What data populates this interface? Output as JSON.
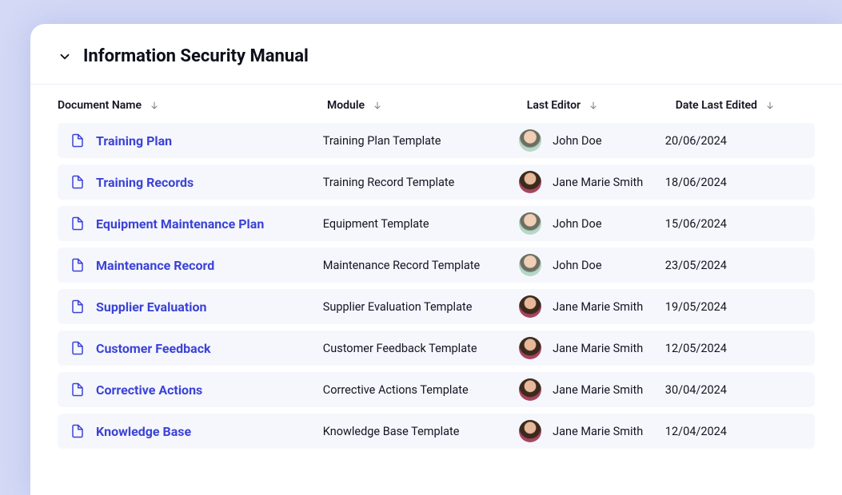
{
  "header": {
    "title": "Information Security Manual"
  },
  "columns": {
    "name": "Document Name",
    "module": "Module",
    "editor": "Last Editor",
    "date": "Date Last Edited"
  },
  "rows": [
    {
      "name": "Training Plan",
      "module": "Training Plan Template",
      "editor": "John Doe",
      "avatar": "john",
      "date": "20/06/2024"
    },
    {
      "name": "Training Records",
      "module": "Training Record Template",
      "editor": "Jane Marie Smith",
      "avatar": "jane",
      "date": "18/06/2024"
    },
    {
      "name": "Equipment Maintenance Plan",
      "module": "Equipment Template",
      "editor": "John Doe",
      "avatar": "john",
      "date": "15/06/2024"
    },
    {
      "name": "Maintenance Record",
      "module": "Maintenance Record Template",
      "editor": "John Doe",
      "avatar": "john",
      "date": "23/05/2024"
    },
    {
      "name": "Supplier Evaluation",
      "module": "Supplier Evaluation Template",
      "editor": "Jane Marie Smith",
      "avatar": "jane",
      "date": "19/05/2024"
    },
    {
      "name": "Customer Feedback",
      "module": "Customer Feedback Template",
      "editor": "Jane Marie Smith",
      "avatar": "jane",
      "date": "12/05/2024"
    },
    {
      "name": "Corrective Actions",
      "module": "Corrective Actions Template",
      "editor": "Jane Marie Smith",
      "avatar": "jane",
      "date": "30/04/2024"
    },
    {
      "name": "Knowledge Base",
      "module": "Knowledge Base Template",
      "editor": "Jane Marie Smith",
      "avatar": "jane",
      "date": "12/04/2024"
    }
  ]
}
